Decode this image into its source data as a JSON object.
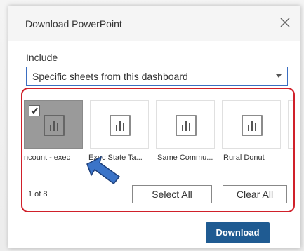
{
  "dialog": {
    "title": "Download PowerPoint",
    "close_icon": "close-icon"
  },
  "include": {
    "label": "Include",
    "selected": "Specific sheets from this dashboard"
  },
  "sheets": [
    {
      "label": "ncount - exec",
      "selected": true
    },
    {
      "label": "Exec State Ta...",
      "selected": false
    },
    {
      "label": "Same Commu...",
      "selected": false
    },
    {
      "label": "Rural Donut",
      "selected": false
    }
  ],
  "pager": {
    "text": "1 of 8"
  },
  "buttons": {
    "select_all": "Select All",
    "clear_all": "Clear All",
    "download": "Download"
  },
  "colors": {
    "accent": "#1f5b92",
    "highlight_border": "#d0202a",
    "annotation_arrow": "#3b74c8"
  }
}
